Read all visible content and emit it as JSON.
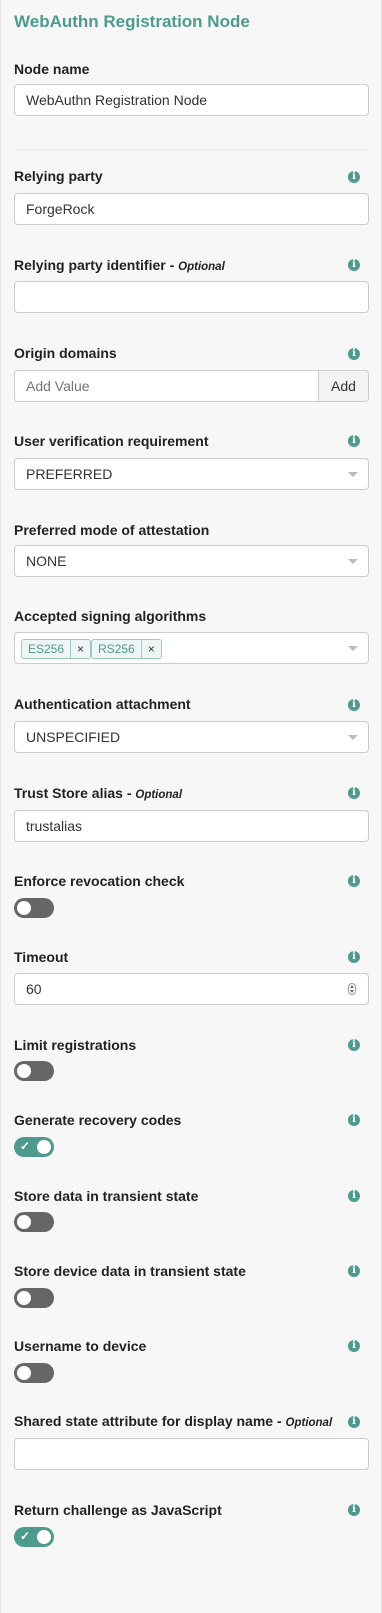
{
  "title": "WebAuthn Registration Node",
  "colors": {
    "accent": "#4f9a8f",
    "toggle_off": "#666666"
  },
  "fields": {
    "node_name": {
      "label": "Node name",
      "value": "WebAuthn Registration Node"
    },
    "relying_party": {
      "label": "Relying party",
      "value": "ForgeRock"
    },
    "relying_party_identifier": {
      "label": "Relying party identifier - ",
      "optional": "Optional",
      "value": ""
    },
    "origin_domains": {
      "label": "Origin domains",
      "placeholder": "Add Value",
      "add_label": "Add"
    },
    "user_verification": {
      "label": "User verification requirement",
      "value": "PREFERRED"
    },
    "attestation_mode": {
      "label": "Preferred mode of attestation",
      "value": "NONE"
    },
    "signing_algorithms": {
      "label": "Accepted signing algorithms",
      "tags": [
        "ES256",
        "RS256"
      ],
      "remove_glyph": "×"
    },
    "authentication_attachment": {
      "label": "Authentication attachment",
      "value": "UNSPECIFIED"
    },
    "trust_store_alias": {
      "label": "Trust Store alias - ",
      "optional": "Optional",
      "value": "trustalias"
    },
    "enforce_revocation": {
      "label": "Enforce revocation check",
      "on": false
    },
    "timeout": {
      "label": "Timeout",
      "value": "60"
    },
    "limit_registrations": {
      "label": "Limit registrations",
      "on": false
    },
    "recovery_codes": {
      "label": "Generate recovery codes",
      "on": true
    },
    "store_transient": {
      "label": "Store data in transient state",
      "on": false
    },
    "store_device_transient": {
      "label": "Store device data in transient state",
      "on": false
    },
    "username_to_device": {
      "label": "Username to device",
      "on": false
    },
    "display_name_attribute": {
      "label": "Shared state attribute for display name - ",
      "optional": "Optional",
      "value": ""
    },
    "return_challenge_js": {
      "label": "Return challenge as JavaScript",
      "on": true
    }
  },
  "icons": {
    "info": "info-icon",
    "check": "check-icon"
  }
}
